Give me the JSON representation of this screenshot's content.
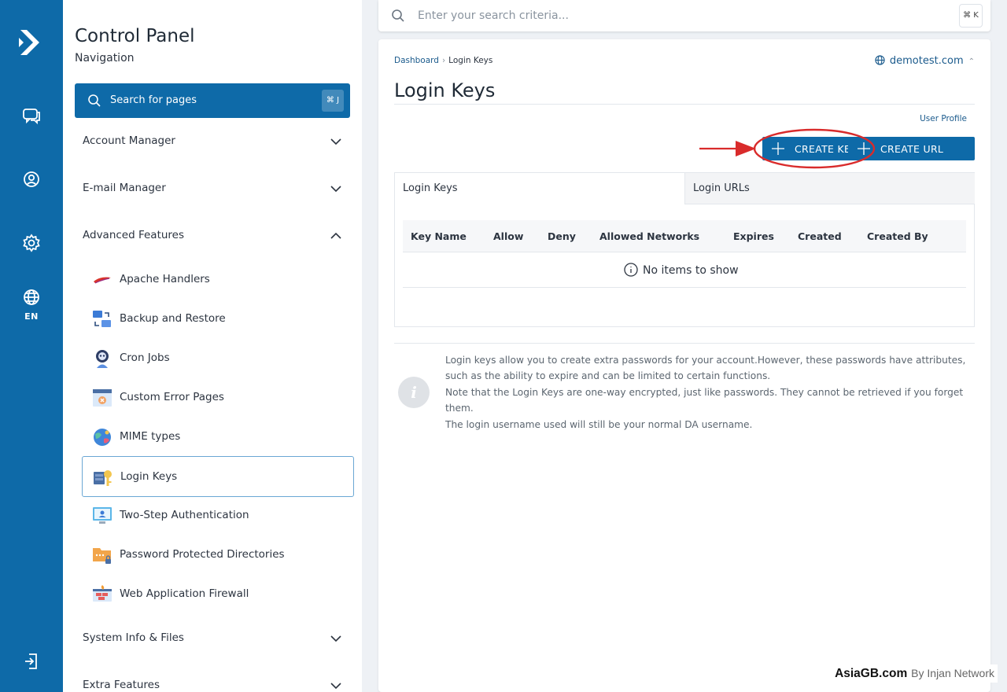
{
  "rail": {
    "language": "EN"
  },
  "nav": {
    "title": "Control Panel",
    "subtitle": "Navigation",
    "search_placeholder": "Search for pages",
    "search_shortcut": "⌘ J",
    "sections": [
      {
        "label": "Account Manager",
        "expanded": false
      },
      {
        "label": "E-mail Manager",
        "expanded": false
      },
      {
        "label": "Advanced Features",
        "expanded": true
      },
      {
        "label": "System Info & Files",
        "expanded": false
      },
      {
        "label": "Extra Features",
        "expanded": false
      }
    ],
    "items": [
      {
        "label": "Apache Handlers",
        "icon": "apache-feather-icon"
      },
      {
        "label": "Backup and Restore",
        "icon": "backup-icon"
      },
      {
        "label": "Cron Jobs",
        "icon": "robot-icon"
      },
      {
        "label": "Custom Error Pages",
        "icon": "error-page-icon"
      },
      {
        "label": "MIME types",
        "icon": "mime-globe-icon"
      },
      {
        "label": "Login Keys",
        "icon": "key-icon",
        "active": true
      },
      {
        "label": "Two-Step Authentication",
        "icon": "two-step-icon"
      },
      {
        "label": "Password Protected Directories",
        "icon": "locked-folder-icon"
      },
      {
        "label": "Web Application Firewall",
        "icon": "firewall-icon"
      }
    ]
  },
  "topbar": {
    "search_placeholder": "Enter your search criteria...",
    "shortcut": "⌘ K"
  },
  "breadcrumb": {
    "home": "Dashboard",
    "current": "Login Keys"
  },
  "domain": "demotest.com",
  "page_title": "Login Keys",
  "user_profile_link": "User Profile",
  "buttons": {
    "create_key": "CREATE KEY",
    "create_url": "CREATE URL"
  },
  "tabs": [
    "Login Keys",
    "Login URLs"
  ],
  "table": {
    "columns": [
      "Key Name",
      "Allow",
      "Deny",
      "Allowed Networks",
      "Expires",
      "Created",
      "Created By"
    ],
    "empty_text": "No items to show"
  },
  "info": {
    "lines": [
      "Login keys allow you to create extra passwords for your account.However, these passwords have attributes, such as the ability to expire and can be limited to certain functions.",
      "Note that the Login Keys are one-way encrypted, just like passwords. They cannot be retrieved if you forget them.",
      "The login username used will still be your normal DA username."
    ]
  },
  "watermark": {
    "brand": "AsiaGB.com",
    "by": "By Injan Network"
  },
  "colors": {
    "primary": "#0e6aa8",
    "annotation": "#d92b2b",
    "link": "#1a5a8c"
  }
}
